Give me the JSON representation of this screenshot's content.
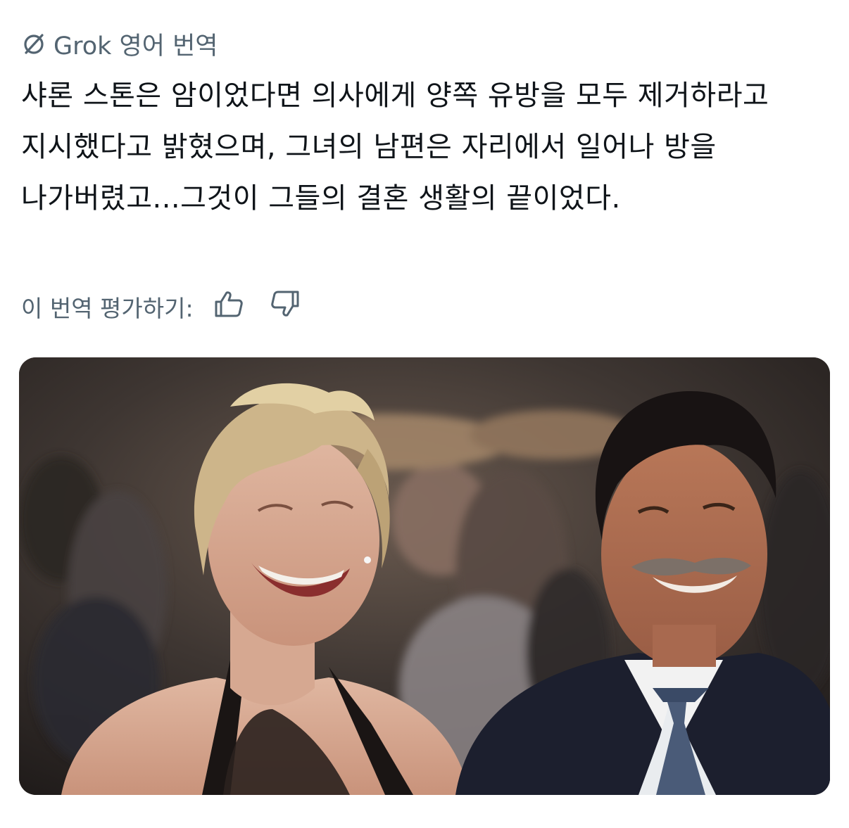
{
  "header": {
    "icon": "grok-slash-icon",
    "label": "Grok 영어 번역"
  },
  "translation": {
    "text": "샤론 스톤은 암이었다면 의사에게 양쪽 유방을 모두 제거하라고 지시했다고 밝혔으며, 그녀의 남편은 자리에서 일어나 방을 나가버렸고...그것이 그들의 결혼 생활의 끝이었다."
  },
  "rating": {
    "label": "이 번역 평가하기:",
    "thumbs_up_icon": "thumbs-up-icon",
    "thumbs_down_icon": "thumbs-down-icon"
  },
  "media": {
    "kind": "photo",
    "description_colors": {
      "accent": "#536471",
      "text": "#0f1419"
    }
  }
}
